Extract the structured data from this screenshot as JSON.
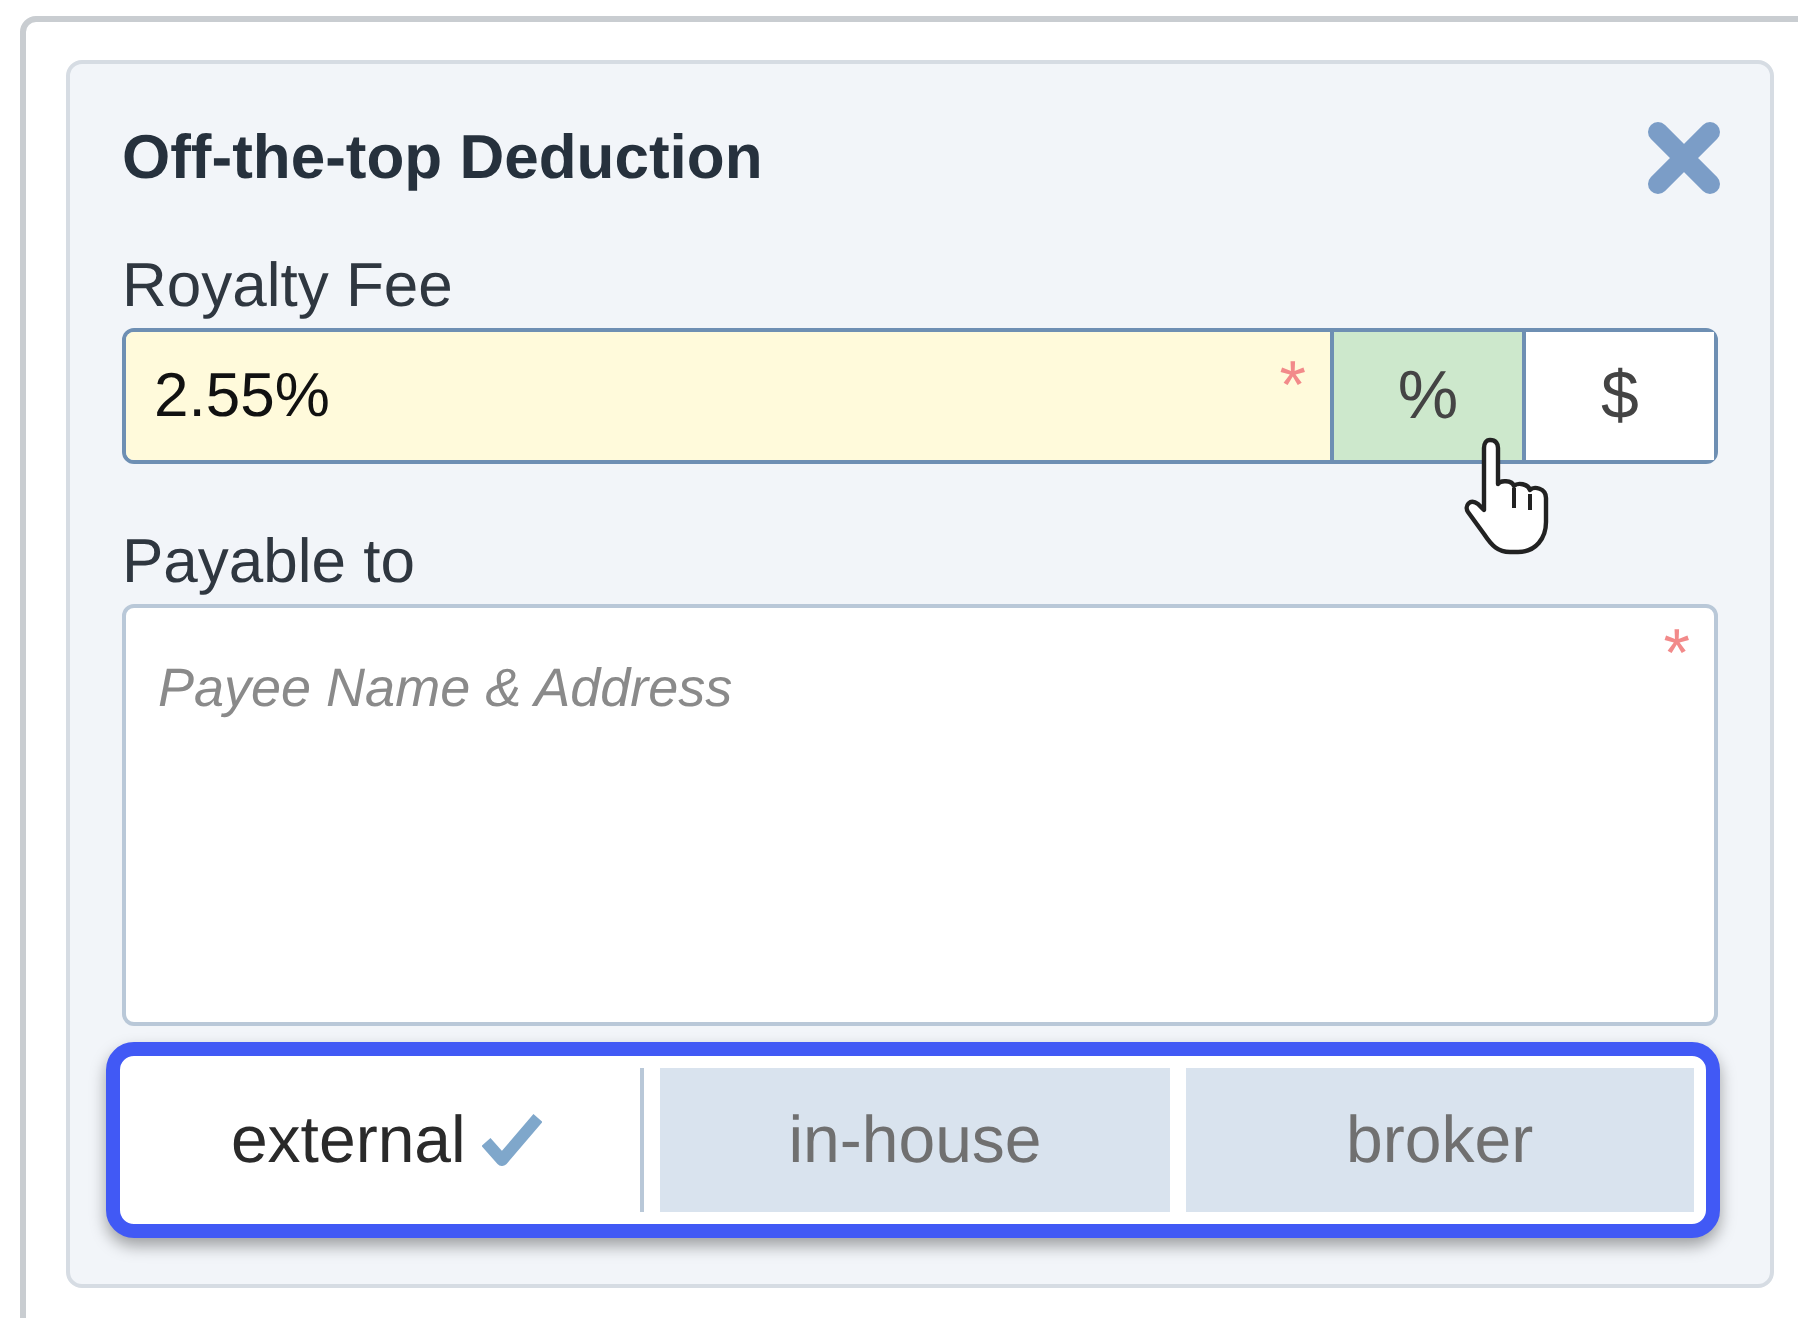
{
  "dialog": {
    "title": "Off-the-top Deduction"
  },
  "royalty_fee": {
    "label": "Royalty Fee",
    "value": "2.55%",
    "required_mark": "*",
    "units": [
      {
        "label": "%",
        "selected": true
      },
      {
        "label": "$",
        "selected": false
      }
    ]
  },
  "payable_to": {
    "label": "Payable to",
    "placeholder": "Payee Name & Address",
    "required_mark": "*"
  },
  "payee_type": [
    {
      "label": "external",
      "selected": true
    },
    {
      "label": "in-house",
      "selected": false
    },
    {
      "label": "broker",
      "selected": false
    }
  ]
}
